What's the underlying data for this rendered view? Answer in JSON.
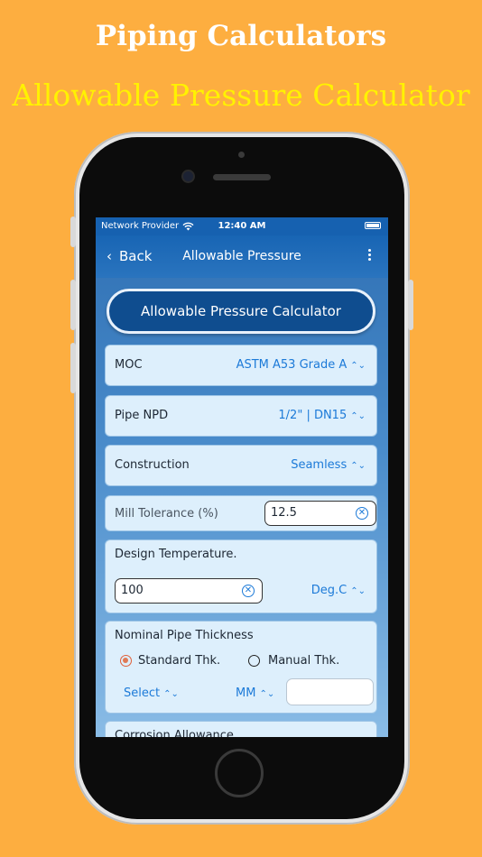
{
  "promo": {
    "title": "Piping Calculators",
    "subtitle": "Allowable Pressure Calculator"
  },
  "status_bar": {
    "carrier": "Network Provider",
    "time": "12:40 AM"
  },
  "nav": {
    "back_label": "Back",
    "title": "Allowable Pressure"
  },
  "main": {
    "calculator_button": "Allowable Pressure Calculator",
    "moc": {
      "label": "MOC",
      "value": "ASTM A53 Grade A"
    },
    "pipe_npd": {
      "label": "Pipe NPD",
      "value": "1/2\" | DN15"
    },
    "construction": {
      "label": "Construction",
      "value": "Seamless"
    },
    "mill_tolerance": {
      "label": "Mill Tolerance (%)",
      "value": "12.5"
    },
    "design_temperature": {
      "label": "Design Temperature.",
      "value": "100",
      "unit": "Deg.C"
    },
    "nominal_thickness": {
      "label": "Nominal Pipe Thickness",
      "option_standard": "Standard Thk.",
      "option_manual": "Manual Thk.",
      "selected": "Standard Thk.",
      "select_label": "Select",
      "unit": "MM",
      "value": ""
    },
    "corrosion": {
      "label": "Corrosion Allowance"
    }
  },
  "colors": {
    "background": "#FDAE40",
    "headline_primary": "#FFFFFF",
    "headline_secondary": "#FFF200",
    "nav_bar": "#1865B4",
    "accent": "#1C7AD8",
    "radio_selected": "#E07A55"
  },
  "icons": {
    "back": "chevron-left-icon",
    "more": "more-vertical-icon",
    "clear": "clear-circle-icon",
    "picker": "up-down-chevron-icon",
    "wifi": "wifi-icon",
    "battery": "battery-icon"
  }
}
